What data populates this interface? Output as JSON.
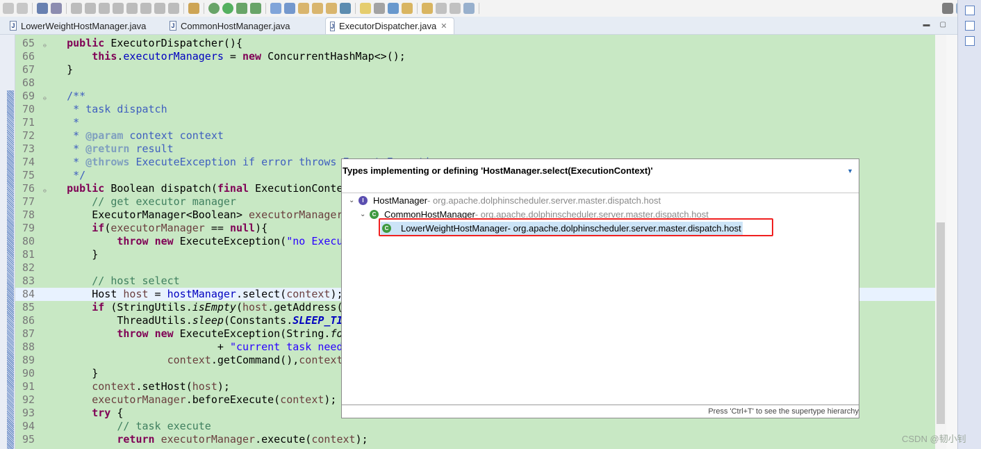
{
  "toolbar": {
    "icons": [
      "save-icon",
      "save-all-icon",
      "console-icon",
      "skip-breakpoints-icon",
      "resume-icon",
      "suspend-icon",
      "terminate-icon",
      "disconnect-icon",
      "step-into-icon",
      "step-over-icon",
      "step-return-icon",
      "drop-to-frame-icon",
      "use-step-filters-icon",
      "debug-icon",
      "run-icon",
      "coverage-icon",
      "external-tools-icon",
      "new-class-icon",
      "new-package-icon",
      "open-type-icon",
      "open-task-icon",
      "search-icon",
      "toggle-mark-occurrences-icon",
      "toggle-breadcrumb-icon",
      "show-whitespace-icon",
      "web-browser-icon",
      "next-annotation-icon",
      "previous-annotation-icon",
      "back-icon",
      "forward-icon",
      "pin-editor-icon",
      "quick-access-search-icon",
      "open-perspective-icon",
      "java-perspective-icon"
    ]
  },
  "tabs": [
    {
      "label": "LowerWeightHostManager.java",
      "active": false
    },
    {
      "label": "CommonHostManager.java",
      "active": false
    },
    {
      "label": "ExecutorDispatcher.java",
      "active": true,
      "close": "✕"
    }
  ],
  "editor": {
    "highlighted_line": 84,
    "lines": [
      {
        "n": "65",
        "fold": "⊖",
        "t": [
          [
            "pl",
            "    "
          ],
          [
            "kw",
            "public"
          ],
          [
            "pl",
            " ExecutorDispatcher(){"
          ]
        ]
      },
      {
        "n": "66",
        "t": [
          [
            "pl",
            "        "
          ],
          [
            "kw",
            "this"
          ],
          [
            "pl",
            "."
          ],
          [
            "fd",
            "executorManagers"
          ],
          [
            "pl",
            " = "
          ],
          [
            "kw",
            "new"
          ],
          [
            "pl",
            " ConcurrentHashMap<>();"
          ]
        ]
      },
      {
        "n": "67",
        "t": [
          [
            "pl",
            "    }"
          ]
        ]
      },
      {
        "n": "68",
        "t": []
      },
      {
        "n": "69",
        "fold": "⊖",
        "t": [
          [
            "jd",
            "    /**"
          ]
        ]
      },
      {
        "n": "70",
        "t": [
          [
            "jd",
            "     * task dispatch"
          ]
        ]
      },
      {
        "n": "71",
        "t": [
          [
            "jd",
            "     *"
          ]
        ]
      },
      {
        "n": "72",
        "t": [
          [
            "jd",
            "     * "
          ],
          [
            "tg",
            "@param"
          ],
          [
            "jd",
            " context context"
          ]
        ]
      },
      {
        "n": "73",
        "t": [
          [
            "jd",
            "     * "
          ],
          [
            "tg",
            "@return"
          ],
          [
            "jd",
            " result"
          ]
        ]
      },
      {
        "n": "74",
        "t": [
          [
            "jd",
            "     * "
          ],
          [
            "tg",
            "@throws"
          ],
          [
            "jd",
            " ExecuteException if error throws ExecuteException"
          ]
        ]
      },
      {
        "n": "75",
        "t": [
          [
            "jd",
            "     */"
          ]
        ]
      },
      {
        "n": "76",
        "fold": "⊖",
        "t": [
          [
            "pl",
            "    "
          ],
          [
            "kw",
            "public"
          ],
          [
            "pl",
            " Boolean dispatch("
          ],
          [
            "kw",
            "final"
          ],
          [
            "pl",
            " ExecutionConte"
          ]
        ]
      },
      {
        "n": "77",
        "t": [
          [
            "cm",
            "        // get executor manager"
          ]
        ]
      },
      {
        "n": "78",
        "t": [
          [
            "pl",
            "        ExecutorManager<Boolean> "
          ],
          [
            "vr",
            "executorManager"
          ]
        ]
      },
      {
        "n": "79",
        "t": [
          [
            "pl",
            "        "
          ],
          [
            "kw",
            "if"
          ],
          [
            "pl",
            "("
          ],
          [
            "vr",
            "executorManager"
          ],
          [
            "pl",
            " == "
          ],
          [
            "kw",
            "null"
          ],
          [
            "pl",
            "){"
          ]
        ]
      },
      {
        "n": "80",
        "t": [
          [
            "pl",
            "            "
          ],
          [
            "kw",
            "throw"
          ],
          [
            "pl",
            " "
          ],
          [
            "kw",
            "new"
          ],
          [
            "pl",
            " ExecuteException("
          ],
          [
            "st",
            "\"no Execu"
          ]
        ]
      },
      {
        "n": "81",
        "t": [
          [
            "pl",
            "        }"
          ]
        ]
      },
      {
        "n": "82",
        "t": []
      },
      {
        "n": "83",
        "t": [
          [
            "cm",
            "        // host select"
          ]
        ]
      },
      {
        "n": "84",
        "t": [
          [
            "pl",
            "        Host "
          ],
          [
            "vr",
            "host"
          ],
          [
            "pl",
            " = "
          ],
          [
            "fd",
            "hostManager"
          ],
          [
            "pl",
            ".select("
          ],
          [
            "vr",
            "context"
          ],
          [
            "pl",
            ");"
          ]
        ]
      },
      {
        "n": "85",
        "t": [
          [
            "pl",
            "        "
          ],
          [
            "kw",
            "if"
          ],
          [
            "pl",
            " (StringUtils."
          ],
          [
            "it",
            "isEmpty"
          ],
          [
            "pl",
            "("
          ],
          [
            "vr",
            "host"
          ],
          [
            "pl",
            ".getAddress("
          ]
        ]
      },
      {
        "n": "86",
        "t": [
          [
            "pl",
            "            ThreadUtils."
          ],
          [
            "it",
            "sleep"
          ],
          [
            "pl",
            "(Constants."
          ],
          [
            "cs",
            "SLEEP_TI"
          ]
        ]
      },
      {
        "n": "87",
        "t": [
          [
            "pl",
            "            "
          ],
          [
            "kw",
            "throw"
          ],
          [
            "pl",
            " "
          ],
          [
            "kw",
            "new"
          ],
          [
            "pl",
            " ExecuteException(String."
          ],
          [
            "it",
            "fo"
          ]
        ]
      },
      {
        "n": "88",
        "t": [
          [
            "pl",
            "                            + "
          ],
          [
            "st",
            "\"current task need"
          ]
        ]
      },
      {
        "n": "89",
        "t": [
          [
            "pl",
            "                    "
          ],
          [
            "vr",
            "context"
          ],
          [
            "pl",
            ".getCommand(),"
          ],
          [
            "vr",
            "context"
          ]
        ]
      },
      {
        "n": "90",
        "t": [
          [
            "pl",
            "        }"
          ]
        ]
      },
      {
        "n": "91",
        "t": [
          [
            "pl",
            "        "
          ],
          [
            "vr",
            "context"
          ],
          [
            "pl",
            ".setHost("
          ],
          [
            "vr",
            "host"
          ],
          [
            "pl",
            ");"
          ]
        ]
      },
      {
        "n": "92",
        "t": [
          [
            "pl",
            "        "
          ],
          [
            "vr",
            "executorManager"
          ],
          [
            "pl",
            ".beforeExecute("
          ],
          [
            "vr",
            "context"
          ],
          [
            "pl",
            ");"
          ]
        ]
      },
      {
        "n": "93",
        "t": [
          [
            "pl",
            "        "
          ],
          [
            "kw",
            "try"
          ],
          [
            "pl",
            " {"
          ]
        ]
      },
      {
        "n": "94",
        "t": [
          [
            "cm",
            "            // task execute"
          ]
        ]
      },
      {
        "n": "95",
        "t": [
          [
            "pl",
            "            "
          ],
          [
            "kw",
            "return"
          ],
          [
            "pl",
            " "
          ],
          [
            "vr",
            "executorManager"
          ],
          [
            "pl",
            ".execute("
          ],
          [
            "vr",
            "context"
          ],
          [
            "pl",
            ");"
          ]
        ]
      }
    ]
  },
  "popup": {
    "title": "Types implementing or defining 'HostManager.select(ExecutionContext)'",
    "filter_value": "",
    "tree": [
      {
        "name": "HostManager",
        "pkg": " - org.apache.dolphinscheduler.server.master.dispatch.host",
        "icon": "interface-icon",
        "icon_text": "I",
        "icon_color": "#5b4fb0",
        "expanded": true
      },
      {
        "name": "CommonHostManager",
        "pkg": " - org.apache.dolphinscheduler.server.master.dispatch.host",
        "icon": "abstract-class-icon",
        "icon_text": "C",
        "icon_color": "#3f9a3f",
        "expanded": true
      },
      {
        "name": "LowerWeightHostManager",
        "pkg": " - org.apache.dolphinscheduler.server.master.dispatch.host",
        "icon": "class-icon",
        "icon_text": "C",
        "icon_color": "#3f9a3f",
        "selected": true
      }
    ],
    "footer": "Press 'Ctrl+T' to see the supertype hierarchy"
  },
  "annotation_color": "#f02020",
  "watermark": "CSDN @韧小钊"
}
